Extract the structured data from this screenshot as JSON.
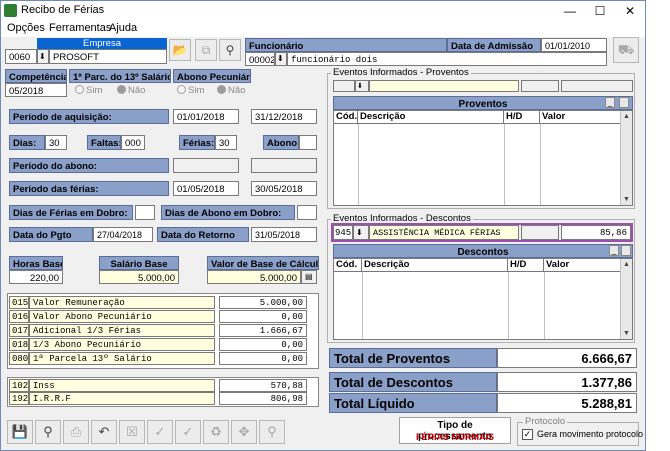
{
  "window": {
    "title": "Recibo de Férias"
  },
  "menu": [
    "Opções",
    "Ferramentas",
    "Ajuda"
  ],
  "empresa": {
    "label": "Empresa",
    "code": "0060",
    "name": "PROSOFT"
  },
  "funcionario": {
    "label": "Funcionário",
    "code": "00002",
    "name": "funcionário dois",
    "admissao_label": "Data de Admissão",
    "admissao": "01/01/2010"
  },
  "competencia": {
    "label": "Competência",
    "value": "05/2018"
  },
  "parcela13": {
    "label": "1ª Parc. do 13º Salário",
    "sim": "Sim",
    "nao": "Não"
  },
  "abono": {
    "label": "Abono Pecuniário",
    "sim": "Sim",
    "nao": "Não"
  },
  "periodo_aquisicao": {
    "label": "Período de aquisição:",
    "start": "01/01/2018",
    "end": "31/12/2018"
  },
  "dias": {
    "label": "Dias:",
    "value": "30"
  },
  "faltas": {
    "label": "Faltas:",
    "value": "000"
  },
  "ferias": {
    "label": "Férias:",
    "value": "30"
  },
  "abono_dias": {
    "label": "Abono:",
    "value": ""
  },
  "periodo_abono": {
    "label": "Período do abono:",
    "start": "",
    "end": ""
  },
  "periodo_ferias": {
    "label": "Período das férias:",
    "start": "01/05/2018",
    "end": "30/05/2018"
  },
  "dias_ferias_dobro": {
    "label": "Dias de Férias em Dobro:",
    "value": ""
  },
  "dias_abono_dobro": {
    "label": "Dias de Abono em Dobro:",
    "value": ""
  },
  "data_pgto": {
    "label": "Data do Pgto",
    "value": "27/04/2018"
  },
  "data_retorno": {
    "label": "Data do Retorno",
    "value": "31/05/2018"
  },
  "horas_base": {
    "label": "Horas Base",
    "value": "220,00"
  },
  "salario_base": {
    "label": "Salário Base",
    "value": "5.000,00"
  },
  "valor_base_calculo": {
    "label": "Valor de Base de Cálculo",
    "value": "5.000,00"
  },
  "summary_rows": [
    {
      "code": "015",
      "desc": "Valor Remuneração",
      "value": "5.000,00"
    },
    {
      "code": "016",
      "desc": "Valor Abono Pecuniário",
      "value": "0,00"
    },
    {
      "code": "017",
      "desc": "Adicional 1/3 Férias",
      "value": "1.666,67"
    },
    {
      "code": "018",
      "desc": "1/3 Abono Pecuniário",
      "value": "0,00"
    },
    {
      "code": "080",
      "desc": "1ª Parcela 13º Salário",
      "value": "0,00"
    }
  ],
  "tax_rows": [
    {
      "code": "102",
      "desc": "Inss",
      "value": "570,88"
    },
    {
      "code": "192",
      "desc": "I.R.R.F",
      "value": "806,98"
    }
  ],
  "eventos_proventos": {
    "title": "Eventos Informados - Proventos",
    "code": "",
    "desc": "",
    "value": ""
  },
  "proventos": {
    "title": "Proventos",
    "cols": [
      "Cód.",
      "Descrição",
      "H/D",
      "Valor"
    ]
  },
  "eventos_descontos": {
    "title": "Eventos Informados - Descontos",
    "code": "945",
    "desc": "ASSISTÊNCIA MÉDICA FÉRIAS",
    "value": "85,86"
  },
  "descontos": {
    "title": "Descontos",
    "cols": [
      "Cód.",
      "Descrição",
      "H/D",
      "Valor"
    ]
  },
  "totais": {
    "proventos_label": "Total de Proventos",
    "proventos": "6.666,67",
    "descontos_label": "Total de Descontos",
    "descontos": "1.377,86",
    "liquido_label": "Total Líquido",
    "liquido": "5.288,81"
  },
  "processamento": {
    "label": "Tipo de processamento",
    "value": "FÉRIAS NORMAIS"
  },
  "protocolo": {
    "group": "Protocolo",
    "checkbox": "Gera movimento protocolo"
  },
  "colors": {
    "label_bg": "#8aa0c8",
    "highlight_border": "#9c4fb0",
    "status_red": "#c00000",
    "selection_blue": "#0a64d2"
  }
}
